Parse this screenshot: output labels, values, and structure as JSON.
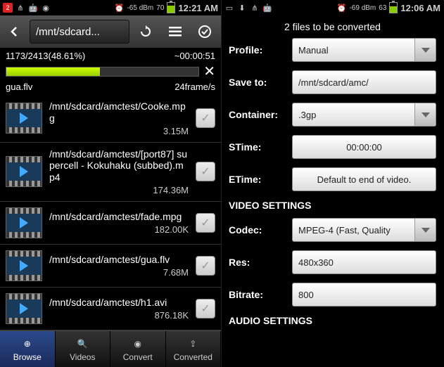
{
  "left": {
    "statusbar": {
      "notif_badge": "2",
      "signal": "-65 dBm",
      "battery": "70",
      "battery_pct": 70,
      "time": "12:21 AM"
    },
    "toolbar": {
      "path": "/mnt/sdcard..."
    },
    "progress": {
      "counter": "1173/2413(48.61%)",
      "eta": "~00:00:51",
      "percent": 48.61,
      "currentfile": "gua.flv",
      "fps": "24frame/s"
    },
    "files": [
      {
        "path": "/mnt/sdcard/amctest/Cooke.mpg",
        "size": "3.15M"
      },
      {
        "path": "/mnt/sdcard/amctest/[port87] supercell - Kokuhaku (subbed).mp4",
        "size": "174.36M"
      },
      {
        "path": "/mnt/sdcard/amctest/fade.mpg",
        "size": "182.00K"
      },
      {
        "path": "/mnt/sdcard/amctest/gua.flv",
        "size": "7.68M"
      },
      {
        "path": "/mnt/sdcard/amctest/h1.avi",
        "size": "876.18K"
      }
    ],
    "tabs": {
      "browse": "Browse",
      "videos": "Videos",
      "convert": "Convert",
      "converted": "Converted"
    }
  },
  "right": {
    "statusbar": {
      "signal": "-69 dBm",
      "battery": "63",
      "battery_pct": 63,
      "time": "12:06 AM"
    },
    "header": "2  files to be converted",
    "form": {
      "profile_label": "Profile:",
      "profile_value": "Manual",
      "saveto_label": "Save to:",
      "saveto_value": "/mnt/sdcard/amc/",
      "container_label": "Container:",
      "container_value": ".3gp",
      "stime_label": "STime:",
      "stime_value": "00:00:00",
      "etime_label": "ETime:",
      "etime_value": "Default to end of video.",
      "video_heading": "VIDEO SETTINGS",
      "codec_label": "Codec:",
      "codec_value": "MPEG-4 (Fast, Quality",
      "res_label": "Res:",
      "res_value": "480x360",
      "bitrate_label": "Bitrate:",
      "bitrate_value": "800",
      "audio_heading": "AUDIO SETTINGS"
    }
  }
}
